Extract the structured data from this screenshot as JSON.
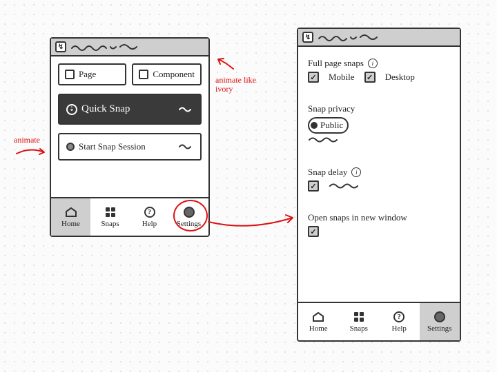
{
  "app": {
    "icon_glyph": "↯",
    "title_placeholder": "———"
  },
  "left": {
    "page_label": "Page",
    "component_label": "Component",
    "quick_snap_label": "Quick Snap",
    "start_session_label": "Start Snap Session"
  },
  "nav": {
    "home": "Home",
    "snaps": "Snaps",
    "help": "Help",
    "help_glyph": "?",
    "settings": "Settings"
  },
  "settings": {
    "full_page_title": "Full page snaps",
    "mobile": "Mobile",
    "desktop": "Desktop",
    "privacy_title": "Snap privacy",
    "privacy_value": "Public",
    "delay_title": "Snap delay",
    "open_new_window_title": "Open snaps in new window"
  },
  "annotations": {
    "left_side": "animate",
    "right_side": "animate like ivory"
  },
  "checks": {
    "checked_glyph": "✓"
  },
  "info_glyph": "i"
}
